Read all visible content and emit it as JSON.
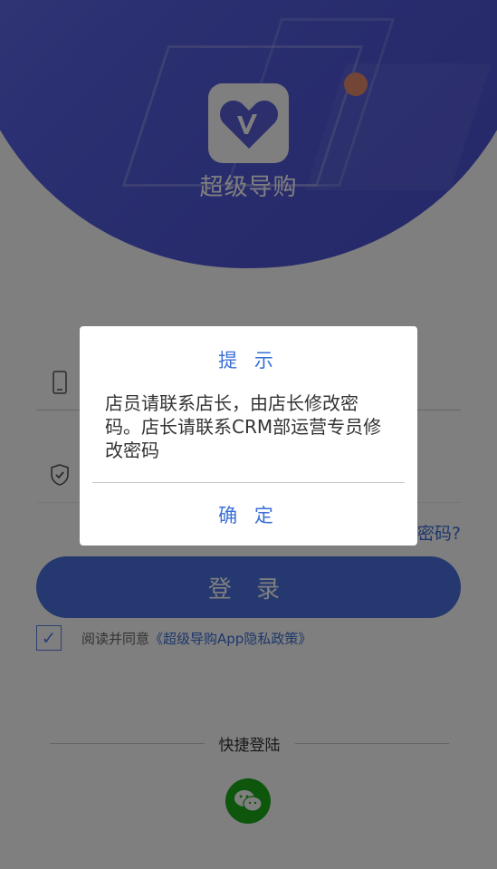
{
  "app": {
    "name": "超级导购",
    "logo_icon": "v-heart-logo-icon"
  },
  "form": {
    "phone_icon": "phone-icon",
    "code_icon": "shield-check-icon",
    "forgot_label": "密码?",
    "login_label": "登 录",
    "agree_text": "阅读并同意",
    "agree_link": "《超级导购App隐私政策》",
    "agree_checked": true
  },
  "quick_login": {
    "label": "快捷登陆",
    "wechat_icon": "wechat-icon"
  },
  "dialog": {
    "title": "提 示",
    "message": "店员请联系店长，由店长修改密码。店长请联系CRM部运营专员修改密码",
    "confirm_label": "确 定"
  },
  "colors": {
    "accent": "#3a6fd8",
    "login_button": "#4b72e0",
    "hero": "#5560e3",
    "wechat": "#1aad19"
  }
}
